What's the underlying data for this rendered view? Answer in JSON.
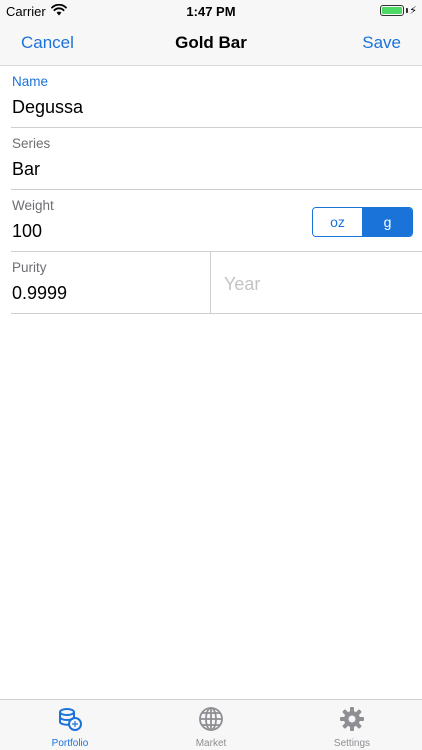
{
  "status_bar": {
    "carrier": "Carrier",
    "time": "1:47 PM",
    "battery_level": 1.0,
    "charging": true
  },
  "nav": {
    "cancel_label": "Cancel",
    "title": "Gold Bar",
    "save_label": "Save"
  },
  "form": {
    "name": {
      "label": "Name",
      "value": "Degussa"
    },
    "series": {
      "label": "Series",
      "value": "Bar"
    },
    "weight": {
      "label": "Weight",
      "value": "100",
      "units": [
        "oz",
        "g"
      ],
      "selected_unit": "g"
    },
    "purity": {
      "label": "Purity",
      "value": "0.9999"
    },
    "year": {
      "placeholder": "Year",
      "value": ""
    }
  },
  "tabs": [
    {
      "label": "Portfolio",
      "icon": "coins-icon",
      "active": true
    },
    {
      "label": "Market",
      "icon": "globe-icon",
      "active": false
    },
    {
      "label": "Settings",
      "icon": "gear-icon",
      "active": false
    }
  ],
  "colors": {
    "accent": "#1a73d9",
    "label_gray": "#6e6e73",
    "placeholder_gray": "#c4c4c6",
    "battery_green": "#4cd964"
  }
}
